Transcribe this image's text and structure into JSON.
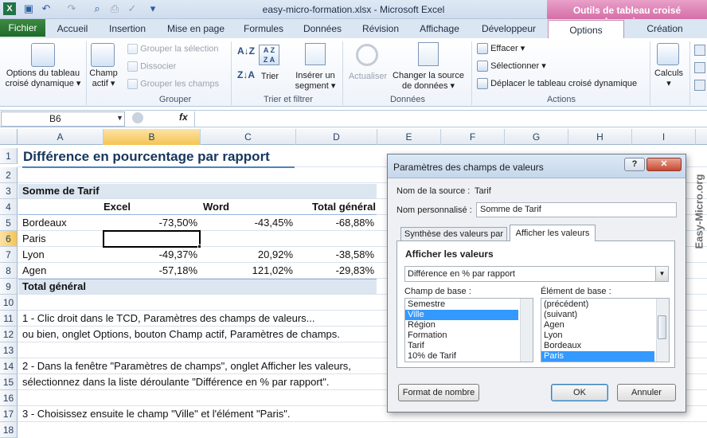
{
  "window": {
    "title": "easy-micro-formation.xlsx  -  Microsoft Excel",
    "context_tools": "Outils de tableau croisé dynamique"
  },
  "tabs": {
    "file": "Fichier",
    "home": "Accueil",
    "insert": "Insertion",
    "layout": "Mise en page",
    "formulas": "Formules",
    "data": "Données",
    "review": "Révision",
    "view": "Affichage",
    "dev": "Développeur",
    "options": "Options",
    "create": "Création"
  },
  "ribbon": {
    "options_btn": [
      "Options du tableau",
      "croisé dynamique ▾"
    ],
    "field_btn": [
      "Champ",
      "actif ▾"
    ],
    "group_sel": "Grouper la sélection",
    "ungroup": "Dissocier",
    "group_fields": "Grouper les champs",
    "group_label": "Grouper",
    "sort": "Trier",
    "insert_segment": [
      "Insérer un",
      "segment ▾"
    ],
    "sort_label": "Trier et filtrer",
    "refresh": "Actualiser",
    "change_source": [
      "Changer la source",
      "de données ▾"
    ],
    "data_label": "Données",
    "clear": "Effacer ▾",
    "select": "Sélectionner ▾",
    "move": "Déplacer le tableau croisé dynamique",
    "actions_label": "Actions",
    "calc": [
      "Calculs",
      "▾"
    ]
  },
  "formula_bar": {
    "name_box": "B6",
    "fx": "fx",
    "value": ""
  },
  "columns": [
    "A",
    "B",
    "C",
    "D",
    "E",
    "F",
    "G",
    "H",
    "I"
  ],
  "rows": [
    "1",
    "2",
    "3",
    "4",
    "5",
    "6",
    "7",
    "8",
    "9",
    "10",
    "11",
    "12",
    "13",
    "14",
    "15",
    "16",
    "17",
    "18"
  ],
  "sheet": {
    "title": "Différence en pourcentage par rapport",
    "sum_label": "Somme de Tarif",
    "headers": [
      "Excel",
      "Word",
      "Total général"
    ],
    "data": [
      {
        "label": "Bordeaux",
        "excel": "-73,50%",
        "word": "-43,45%",
        "total": "-68,88%"
      },
      {
        "label": "Paris",
        "excel": "",
        "word": "",
        "total": ""
      },
      {
        "label": "Lyon",
        "excel": "-49,37%",
        "word": "20,92%",
        "total": "-38,58%"
      },
      {
        "label": "Agen",
        "excel": "-57,18%",
        "word": "121,02%",
        "total": "-29,83%"
      }
    ],
    "grand_total": "Total général",
    "note1": "1 - Clic droit dans le TCD, Paramètres des champs de valeurs...",
    "note2": "ou bien, onglet Options, bouton Champ actif, Paramètres de champs.",
    "note3": "2 - Dans la fenêtre \"Paramètres de champs\", onglet Afficher les valeurs,",
    "note4": "sélectionnez dans la liste déroulante \"Différence en % par rapport\".",
    "note5": "3 - Choisissez ensuite le champ \"Ville\" et l'élément \"Paris\"."
  },
  "dialog": {
    "title": "Paramètres des champs de valeurs",
    "help": "?",
    "close": "✕",
    "source_label": "Nom de la source :",
    "source_value": "Tarif",
    "custom_label": "Nom personnalisé :",
    "custom_value": "Somme de Tarif",
    "tab_summary": "Synthèse des valeurs par",
    "tab_show": "Afficher les valeurs",
    "section": "Afficher les valeurs",
    "dropdown": "Différence en % par rapport",
    "base_field_label": "Champ de base :",
    "base_field_items": [
      "Semestre",
      "Ville",
      "Région",
      "Formation",
      "Tarif",
      "10% de Tarif"
    ],
    "base_item_label": "Élément de base :",
    "base_item_items": [
      "(précédent)",
      "(suivant)",
      "Agen",
      "Lyon",
      "Bordeaux",
      "Paris"
    ],
    "number_format": "Format de nombre",
    "ok": "OK",
    "cancel": "Annuler"
  },
  "watermark": "Easy-Micro.org"
}
